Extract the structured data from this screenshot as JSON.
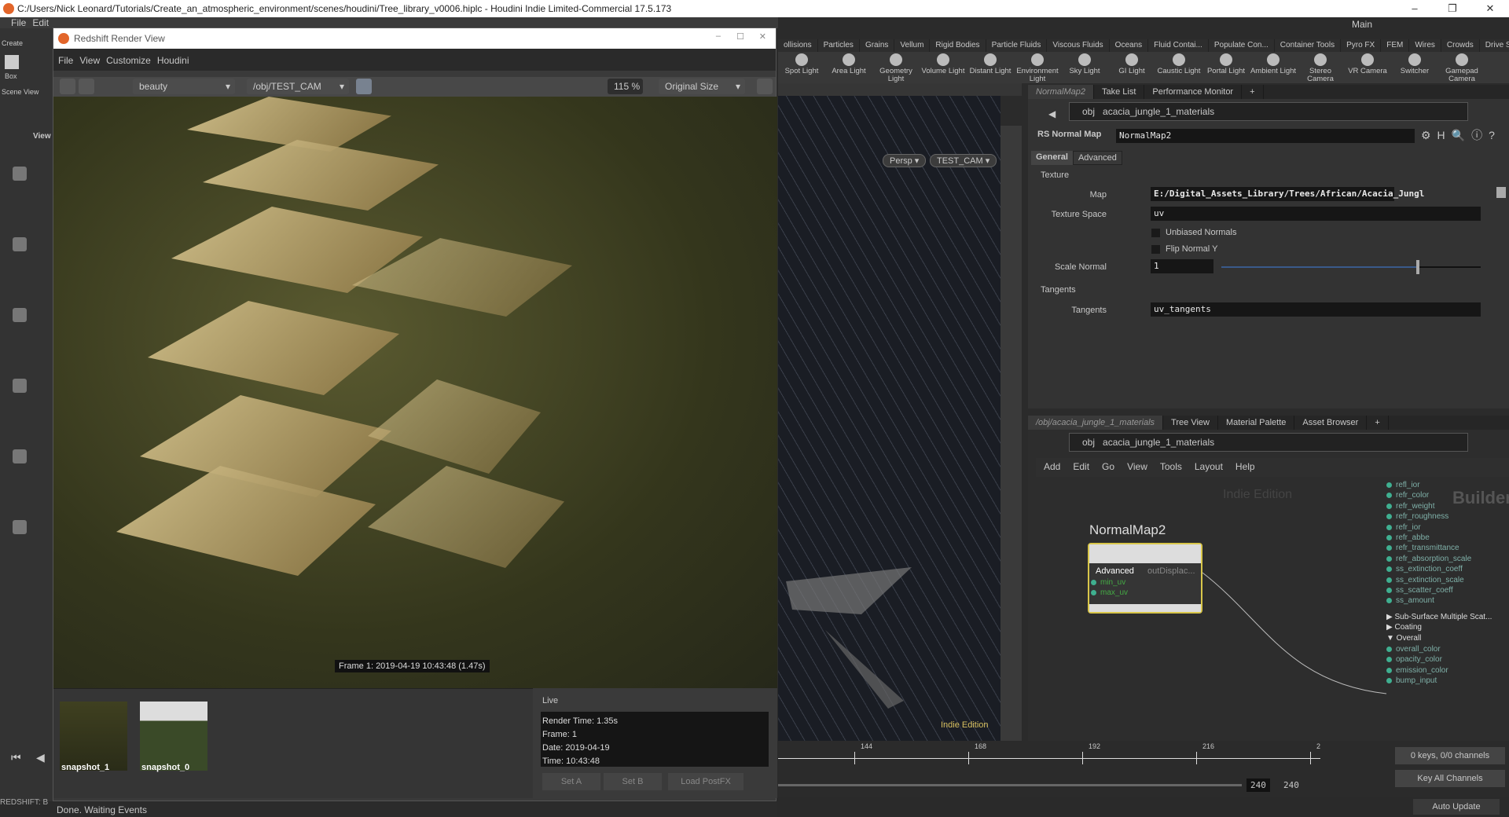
{
  "window": {
    "title": "C:/Users/Nick Leonard/Tutorials/Create_an_atmospheric_environment/scenes/houdini/Tree_library_v0006.hiplc - Houdini Indie Limited-Commercial 17.5.173",
    "desktop": "Main"
  },
  "houdini_menu": [
    "File",
    "Edit"
  ],
  "left_shelf": {
    "create_tab": "Create",
    "box": "Box",
    "scene_view": "Scene View",
    "view": "View"
  },
  "shelf_tabs": [
    "ollisions",
    "Particles",
    "Grains",
    "Vellum",
    "Rigid Bodies",
    "Particle Fluids",
    "Viscous Fluids",
    "Oceans",
    "Fluid Contai...",
    "Populate Con...",
    "Container Tools",
    "Pyro FX",
    "FEM",
    "Wires",
    "Crowds",
    "Drive Simula..."
  ],
  "shelf_tools": [
    "Spot Light",
    "Area Light",
    "Geometry Light",
    "Volume Light",
    "Distant Light",
    "Environment Light",
    "Sky Light",
    "GI Light",
    "Caustic Light",
    "Portal Light",
    "Ambient Light",
    "Stereo Camera",
    "VR Camera",
    "Switcher",
    "Gamepad Camera"
  ],
  "render_view": {
    "title": "Redshift Render View",
    "menu": [
      "File",
      "View",
      "Customize",
      "Houdini"
    ],
    "aov": "beauty",
    "camera": "/obj/TEST_CAM",
    "zoom": "115 %",
    "size_mode": "Original Size",
    "frame_label": "Frame  1:  2019-04-19  10:43:48  (1.47s)",
    "snapshots": [
      {
        "name": "snapshot_1"
      },
      {
        "name": "snapshot_0"
      }
    ],
    "info_mode": "Live",
    "info": [
      "Render Time: 1.35s",
      "Frame: 1",
      "Date: 2019-04-19",
      "Time: 10:43:48"
    ],
    "buttons": [
      "Set A",
      "Set B",
      "Load PostFX"
    ],
    "status": "Done. Waiting Events",
    "redshift_label": "REDSHIFT: B"
  },
  "viewport": {
    "persp": "Persp",
    "camera": "TEST_CAM",
    "edition": "Indie Edition"
  },
  "params": {
    "tabs": [
      "NormalMap2",
      "Take List",
      "Performance Monitor"
    ],
    "path": [
      "obj",
      "acacia_jungle_1_materials"
    ],
    "node_type": "RS Normal Map",
    "node_name": "NormalMap2",
    "subtabs": [
      "General",
      "Advanced"
    ],
    "texture_section": "Texture",
    "map_label": "Map",
    "map_value": "E:/Digital_Assets_Library/Trees/African/Acacia_Jungl",
    "texture_space_label": "Texture Space",
    "texture_space_value": "uv",
    "unbiased_label": "Unbiased Normals",
    "flip_label": "Flip Normal Y",
    "scale_label": "Scale Normal",
    "scale_value": "1",
    "scale_slider_fraction": 0.75,
    "tangents_section": "Tangents",
    "tangents_label": "Tangents",
    "tangents_value": "uv_tangents"
  },
  "network": {
    "tabs": [
      "/obj/acacia_jungle_1_materials",
      "Tree View",
      "Material Palette",
      "Asset Browser"
    ],
    "path": [
      "obj",
      "acacia_jungle_1_materials"
    ],
    "menu": [
      "Add",
      "Edit",
      "Go",
      "View",
      "Tools",
      "Layout",
      "Help"
    ],
    "watermark": "Indie Edition",
    "builder": "Builder",
    "node": {
      "name": "NormalMap2",
      "group": "Advanced",
      "output": "outDisplac...",
      "inputs": [
        "min_uv",
        "max_uv"
      ]
    },
    "material_ports": [
      "refl_ior",
      "refr_color",
      "refr_weight",
      "refr_roughness",
      "refr_ior",
      "refr_abbe",
      "refr_transmittance",
      "refr_absorption_scale",
      "ss_extinction_coeff",
      "ss_extinction_scale",
      "ss_scatter_coeff",
      "ss_amount"
    ],
    "groups": [
      "Sub-Surface Multiple Scat...",
      "Coating",
      "Overall"
    ],
    "overall_ports": [
      "overall_color",
      "opacity_color",
      "emission_color",
      "bump_input"
    ]
  },
  "timeline": {
    "ticks": [
      "144",
      "168",
      "192",
      "216",
      "2"
    ],
    "end1": "240",
    "end2": "240",
    "keys": "0 keys, 0/0 channels",
    "key_all": "Key All Channels",
    "auto_update": "Auto Update"
  }
}
